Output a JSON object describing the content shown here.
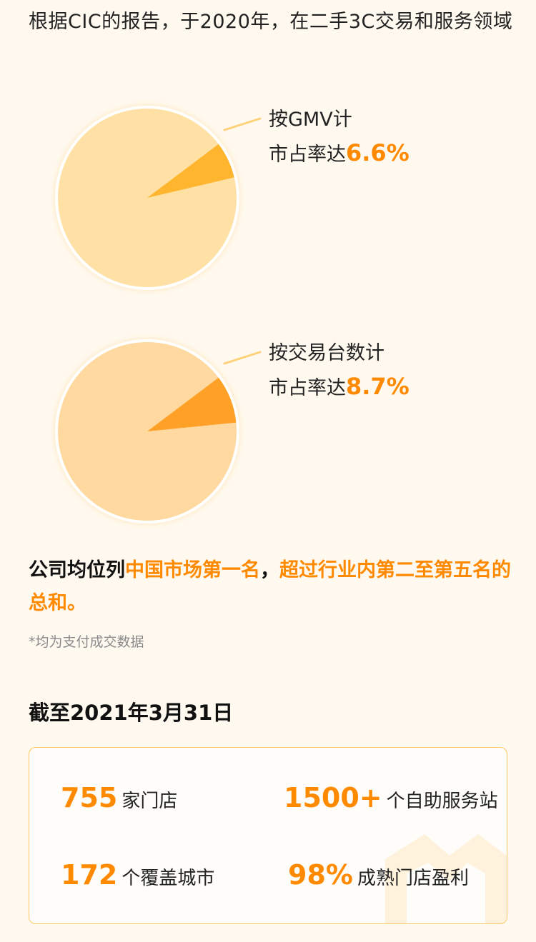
{
  "intro": {
    "text": "根据CIC的报告，于2020年，在二手3C交易和服务领域"
  },
  "pies": [
    {
      "label_line1": "按GMV计",
      "label_line2_prefix": "市占率达",
      "percent_text": "6.6%",
      "share": 0.066,
      "base_color": "#ffe1a6",
      "slice_color": "#ffb52e"
    },
    {
      "label_line1": "按交易台数计",
      "label_line2_prefix": "市占率达",
      "percent_text": "8.7%",
      "share": 0.087,
      "base_color": "#ffd9a0",
      "slice_color": "#ffa126"
    }
  ],
  "summary": {
    "prefix": "公司均位列",
    "highlight1": "中国市场第一名",
    "comma": "，",
    "highlight2": "超过行业内第二至第五名的总和。"
  },
  "footnote": "*均为支付成交数据",
  "section_title": "截至2021年3月31日",
  "stats": [
    {
      "number": "755",
      "label": "家门店"
    },
    {
      "number": "1500+",
      "label": "个自助服务站"
    },
    {
      "number": "172",
      "label": "个覆盖城市"
    },
    {
      "number": "98%",
      "label": "成熟门店盈利"
    }
  ],
  "colors": {
    "accent": "#ff8a00",
    "background": "#fff9ef",
    "card_border": "#ffc860"
  }
}
